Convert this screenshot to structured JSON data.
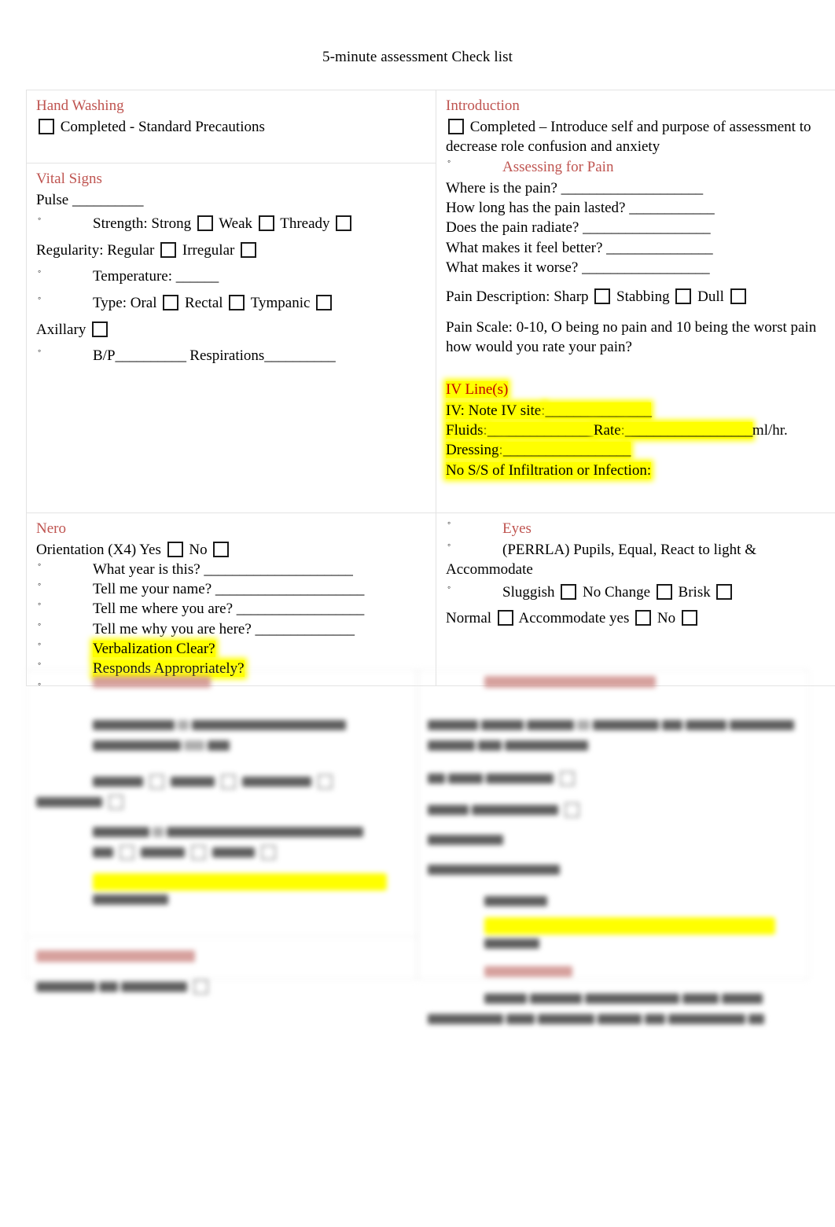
{
  "document": {
    "title": "5-minute assessment Check list"
  },
  "colors": {
    "heading_red": "#bf5450",
    "bright_red": "#c00000",
    "highlight_yellow": "#ffff00",
    "border_gray": "#e3e3e3"
  },
  "table": {
    "rows": [
      {
        "left": {
          "heading": "Hand Washing",
          "lines": [
            {
              "text": "Completed - Standard Precautions"
            }
          ]
        },
        "right": {
          "heading": "Introduction",
          "lines": [
            {
              "text": "Completed – Introduce self and purpose of assessment to decrease role confusion and anxiety"
            }
          ]
        }
      },
      {
        "left": {
          "heading": "Vital Signs",
          "pulse_label": "Pulse",
          "pulse_blank": "__________",
          "strength_label": "Strength: Strong",
          "strength_weak": "Weak",
          "strength_thready": "Thready",
          "regularity_label": "Regularity: Regular",
          "regularity_irregular": "Irregular",
          "temperature_label": "Temperature:",
          "temperature_blank": "______",
          "type_label": "Type: Oral",
          "type_rectal": "Rectal",
          "type_tympanic": "Tympanic",
          "axillary_label": "Axillary",
          "bp_label": "B/P",
          "bp_blank": "__________",
          "respirations_label": "Respirations",
          "respirations_blank": "__________"
        },
        "right": {
          "subheading": "Assessing for Pain",
          "questions": [
            {
              "text": "Where is the pain?",
              "blank": "____________________"
            },
            {
              "text": "How long has the pain lasted?",
              "blank": "____________"
            },
            {
              "text": "Does the pain radiate?",
              "blank": "__________________"
            },
            {
              "text": "What makes it feel better?",
              "blank": "_______________"
            },
            {
              "text": "What makes it worse?",
              "blank": "__________________"
            }
          ],
          "pain_description_label": "Pain Description: Sharp",
          "pain_description_stabbing": "Stabbing",
          "pain_description_dull": "Dull",
          "pain_scale": "Pain Scale: 0-10, O being no pain and 10 being the worst pain how would you rate your pain?",
          "iv_heading": "IV Line(s)",
          "iv_site_label": "IV: Note IV site:",
          "iv_site_blank": "_______________",
          "iv_fluids_label": "Fluids:",
          "iv_fluids_blank": "_______________",
          "iv_rate_label": "Rate:",
          "iv_rate_blank": "__________________",
          "iv_rate_units": "ml/hr.",
          "iv_dressing_label": "Dressing:",
          "iv_dressing_blank": "__________________",
          "iv_no_ss": "No S/S of Infiltration or Infection:"
        }
      },
      {
        "left": {
          "heading": "Nero",
          "orientation_label": "Orientation (X4) Yes",
          "orientation_no": "No",
          "bullets": [
            {
              "text": "What year is this?",
              "blank": "_____________________"
            },
            {
              "text": "Tell me your name?",
              "blank": "_____________________"
            },
            {
              "text": "Tell me where you are?",
              "blank": "__________________"
            },
            {
              "text": "Tell me why you are here?",
              "blank": "______________"
            },
            {
              "text": "Verbalization Clear?",
              "blank": "",
              "highlight": true
            },
            {
              "text": "Responds Appropriately?",
              "blank": "",
              "highlight": true
            }
          ]
        },
        "right": {
          "eyes_heading": "Eyes",
          "perrla": "(PERRLA) Pupils, Equal, React to light & Accommodate",
          "sluggish": "Sluggish",
          "no_change": "No Change",
          "brisk": "Brisk",
          "normal": "Normal",
          "accommodate_yes": "Accommodate yes",
          "accommodate_no": "No"
        }
      }
    ],
    "obscured_note": "Lower portion of the document is blurred and illegible."
  }
}
